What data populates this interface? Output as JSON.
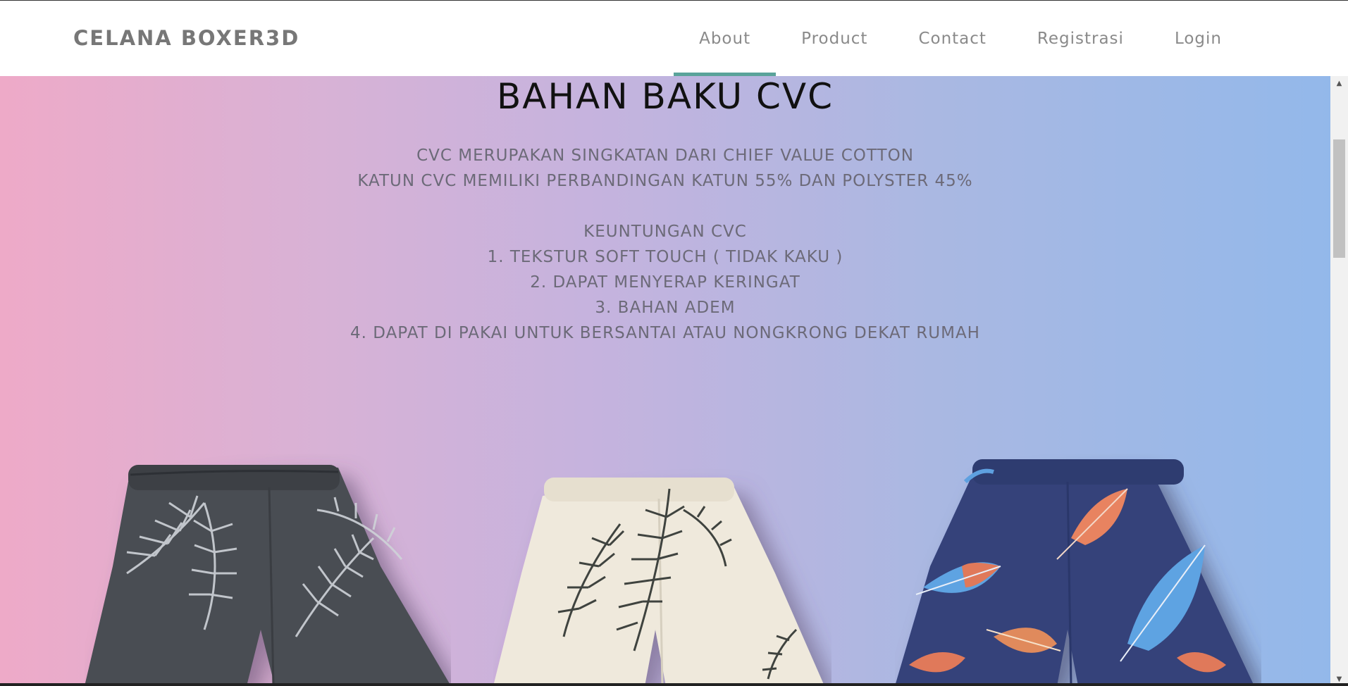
{
  "navbar": {
    "brand": "CELANA BOXER3D",
    "items": [
      {
        "label": "About",
        "active": true
      },
      {
        "label": "Product",
        "active": false
      },
      {
        "label": "Contact",
        "active": false
      },
      {
        "label": "Registrasi",
        "active": false
      },
      {
        "label": "Login",
        "active": false
      }
    ]
  },
  "hero": {
    "title": "BAHAN BAKU CVC",
    "lines": [
      "CVC MERUPAKAN SINGKATAN DARI CHIEF VALUE COTTON",
      "KATUN CVC MEMILIKI PERBANDINGAN KATUN 55% DAN POLYSTER 45%"
    ],
    "benefits_title": "KEUNTUNGAN CVC",
    "benefits": [
      "1. TEKSTUR SOFT TOUCH ( TIDAK KAKU )",
      "2. DAPAT MENYERAP KERINGAT",
      "3. BAHAN ADEM",
      "4. DAPAT DI PAKAI UNTUK BERSANTAI ATAU NONGKRONG DEKAT RUMAH"
    ]
  },
  "colors": {
    "gradient_left": "#eeaac8",
    "gradient_right": "#93b8ea",
    "nav_active_underline": "#5aa39a",
    "brand_text": "#777777",
    "description_text": "#6c6a78"
  },
  "products": [
    {
      "pattern": "dark-gray-palm-leaf-shorts"
    },
    {
      "pattern": "cream-palm-leaf-shorts"
    },
    {
      "pattern": "navy-feather-shorts"
    }
  ]
}
